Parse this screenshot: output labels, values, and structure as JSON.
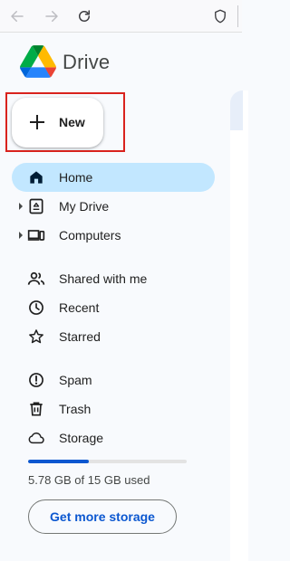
{
  "brand": {
    "name": "Drive"
  },
  "toolbar": {
    "new_label": "New"
  },
  "nav": {
    "home": "Home",
    "my_drive": "My Drive",
    "computers": "Computers",
    "shared": "Shared with me",
    "recent": "Recent",
    "starred": "Starred",
    "spam": "Spam",
    "trash": "Trash",
    "storage": "Storage"
  },
  "storage": {
    "used_text": "5.78 GB of 15 GB used",
    "used_fraction": 0.385,
    "button_label": "Get more storage"
  },
  "colors": {
    "accent": "#0b57d0",
    "active_bg": "#c2e7ff",
    "highlight": "#d9221d"
  },
  "icons": [
    "back-arrow-icon",
    "forward-arrow-icon",
    "reload-icon",
    "shield-icon",
    "plus-icon",
    "home-icon",
    "my-drive-icon",
    "computers-icon",
    "shared-icon",
    "clock-icon",
    "star-icon",
    "spam-icon",
    "trash-icon",
    "cloud-icon"
  ]
}
